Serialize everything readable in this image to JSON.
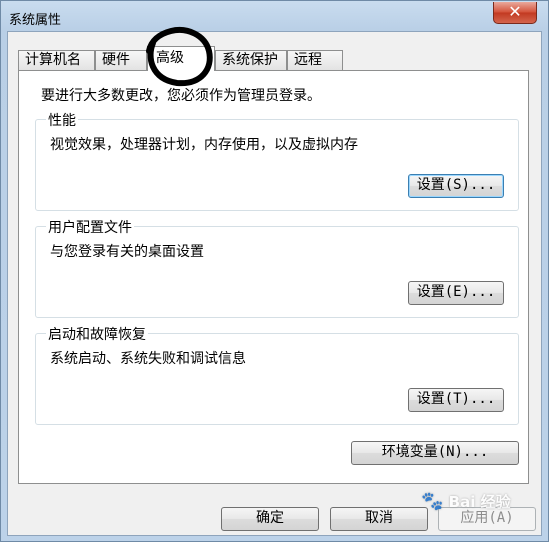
{
  "window": {
    "title": "系统属性",
    "close_glyph": "✕"
  },
  "tabs": [
    {
      "label": "计算机名"
    },
    {
      "label": "硬件"
    },
    {
      "label": "高级"
    },
    {
      "label": "系统保护"
    },
    {
      "label": "远程"
    }
  ],
  "panel": {
    "intro": "要进行大多数更改，您必须作为管理员登录。",
    "performance": {
      "title": "性能",
      "desc": "视觉效果，处理器计划，内存使用，以及虚拟内存",
      "button": "设置(S)..."
    },
    "user_profiles": {
      "title": "用户配置文件",
      "desc": "与您登录有关的桌面设置",
      "button": "设置(E)..."
    },
    "startup_recovery": {
      "title": "启动和故障恢复",
      "desc": "系统启动、系统失败和调试信息",
      "button": "设置(T)..."
    },
    "env_button": "环境变量(N)..."
  },
  "footer": {
    "ok": "确定",
    "cancel": "取消",
    "apply": "应用(A)"
  },
  "watermark": {
    "text": "Bai 经验",
    "icon": "paw-icon"
  }
}
